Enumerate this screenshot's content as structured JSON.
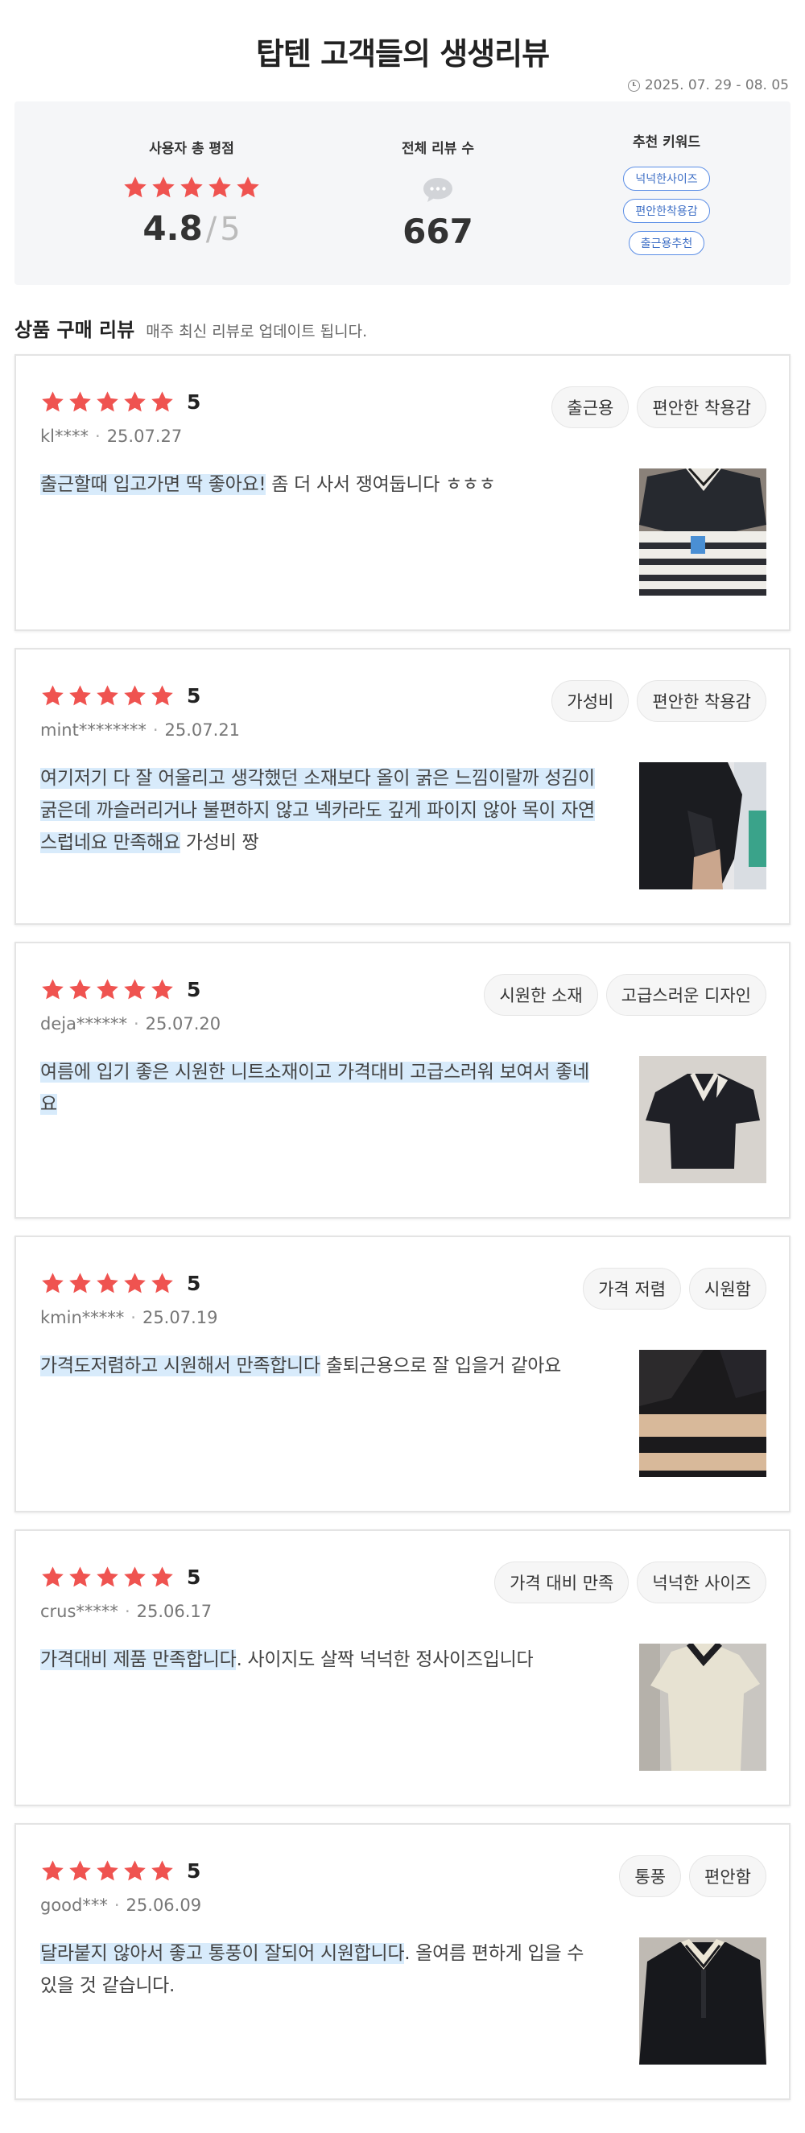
{
  "header": {
    "title": "탑텐 고객들의 생생리뷰",
    "period": "2025. 07. 29 - 08. 05"
  },
  "summary": {
    "rating_label": "사용자 총 평점",
    "rating_value": "4.8",
    "rating_separator": "/",
    "rating_max": "5",
    "rating_fraction": 0.96,
    "reviews_label": "전체 리뷰 수",
    "reviews_count": "667",
    "keywords_label": "추천 키워드",
    "keywords": [
      "넉넉한사이즈",
      "편안한착용감",
      "출근용추천"
    ]
  },
  "section": {
    "title": "상품 구매 리뷰",
    "subtitle": "매주 최신 리뷰로 업데이트 됩니다."
  },
  "reviews": [
    {
      "stars": 5,
      "score": "5",
      "user": "kl****",
      "date": "25.07.27",
      "tags": [
        "출근용",
        "편안한 착용감"
      ],
      "highlight": "출근할때 입고가면 딱 좋아요!",
      "rest": " 좀 더 사서 쟁여둡니다 ㅎㅎㅎ",
      "image": "striped-shirts-photo"
    },
    {
      "stars": 5,
      "score": "5",
      "user": "mint********",
      "date": "25.07.21",
      "tags": [
        "가성비",
        "편안한 착용감"
      ],
      "highlight": "여기저기 다 잘 어울리고 생각했던 소재보다 올이 굵은 느낌이랄까 성김이 굵은데 까슬러리거나 불편하지 않고 넥카라도 깊게 파이지 않아 목이 자연스럽네요 만족해요",
      "rest": " 가성비 짱",
      "image": "black-shirt-worn-photo"
    },
    {
      "stars": 5,
      "score": "5",
      "user": "deja******",
      "date": "25.07.20",
      "tags": [
        "시원한 소재",
        "고급스러운 디자인"
      ],
      "highlight": "여름에 입기 좋은 시원한 니트소재이고 가격대비 고급스러워 보여서 좋네요",
      "rest": "",
      "image": "black-shirt-flat-photo"
    },
    {
      "stars": 5,
      "score": "5",
      "user": "kmin*****",
      "date": "25.07.19",
      "tags": [
        "가격 저렴",
        "시원함"
      ],
      "highlight": "가격도저렴하고 시원해서 만족합니다",
      "rest": " 출퇴근용으로 잘 입을거 같아요",
      "image": "black-beige-stripe-photo"
    },
    {
      "stars": 5,
      "score": "5",
      "user": "crus*****",
      "date": "25.06.17",
      "tags": [
        "가격 대비 만족",
        "넉넉한 사이즈"
      ],
      "highlight": "가격대비 제품 만족합니다",
      "rest": ". 사이지도 살짝 넉넉한 정사이즈입니다",
      "image": "beige-shirt-hanger-photo"
    },
    {
      "stars": 5,
      "score": "5",
      "user": "good***",
      "date": "25.06.09",
      "tags": [
        "통풍",
        "편안함"
      ],
      "highlight": "달라붙지 않아서 좋고 통풍이 잘되어 시원합니다",
      "rest": ". 올여름 편하게 입을 수 있을 것 같습니다.",
      "image": "black-shirt-white-collar-photo"
    }
  ],
  "colors": {
    "star": "#ef5350",
    "highlight": "#d8ebfb",
    "keyword_border": "#5b8ee6",
    "summary_bg": "#f5f6f8"
  }
}
